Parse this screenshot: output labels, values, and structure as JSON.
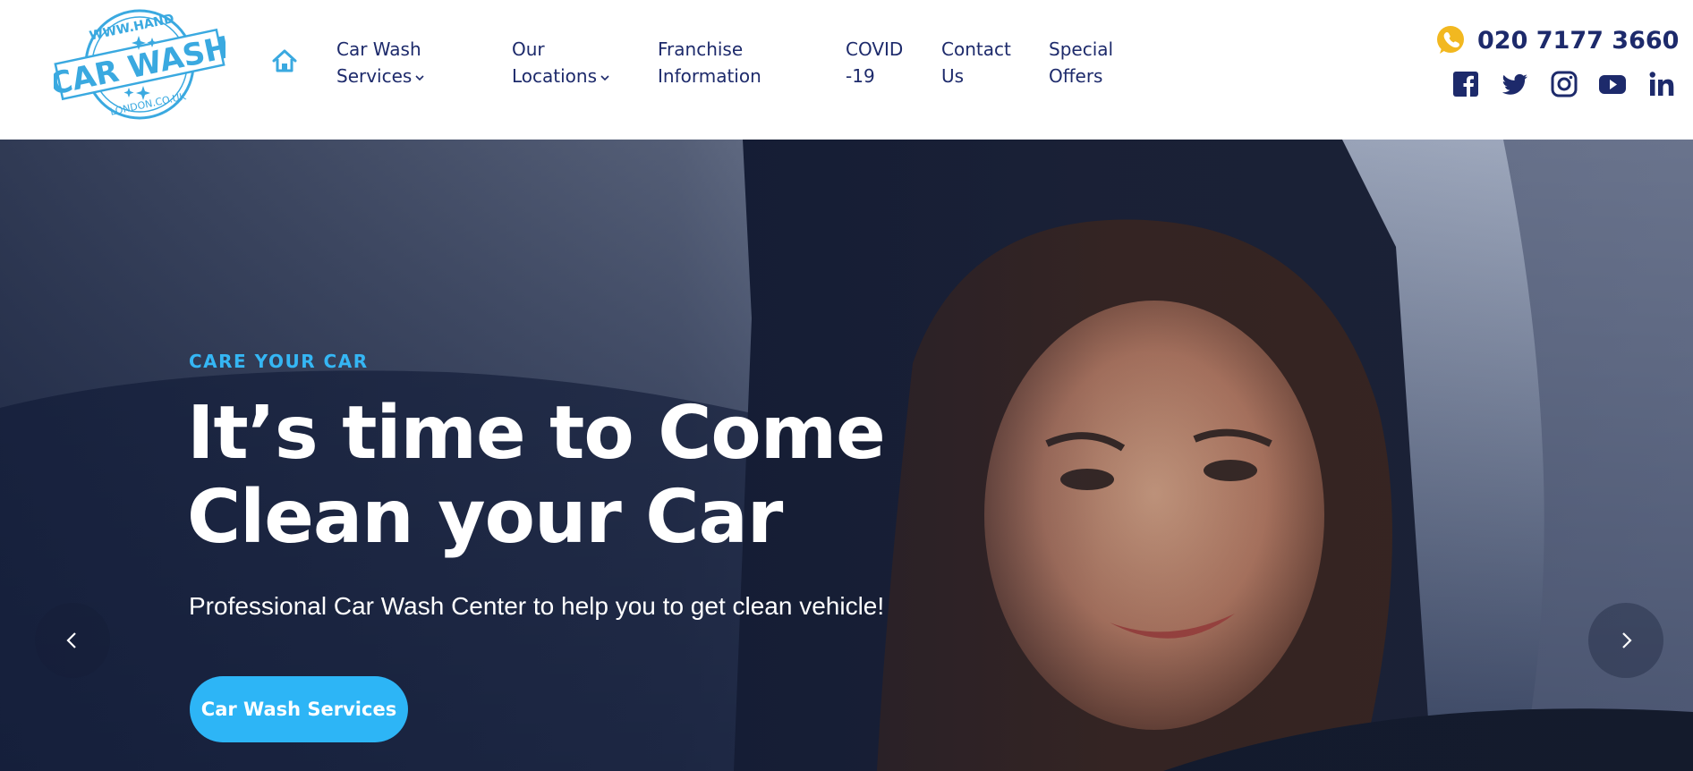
{
  "brand": {
    "logo_text": {
      "top": "WWW.HAND",
      "main": "CAR WASH",
      "bottom": "LONDON.CO.UK"
    },
    "colors": {
      "navy": "#1d2a6b",
      "accent_blue": "#2db5f6",
      "logo_blue": "#3aa9e0",
      "whatsapp_yellow": "#f2b820"
    }
  },
  "nav": {
    "home_icon": "home-icon",
    "items": [
      {
        "line1": "Car Wash",
        "line2": "Services",
        "dropdown": true
      },
      {
        "line1": "Our",
        "line2": "Locations",
        "dropdown": true
      },
      {
        "line1": "Franchise",
        "line2": "Information",
        "dropdown": false
      },
      {
        "line1": "COVID",
        "line2": "-19",
        "dropdown": false
      },
      {
        "line1": "Contact",
        "line2": "Us",
        "dropdown": false
      },
      {
        "line1": "Special",
        "line2": "Offers",
        "dropdown": false
      }
    ]
  },
  "contact": {
    "phone": "020 7177 3660",
    "phone_icon": "whatsapp-icon"
  },
  "social": [
    "facebook-icon",
    "twitter-icon",
    "instagram-icon",
    "youtube-icon",
    "linkedin-icon"
  ],
  "hero": {
    "eyebrow": "CARE YOUR CAR",
    "headline_line1": "It’s time to Come",
    "headline_line2": "Clean your Car",
    "subline": "Professional Car Wash Center to help you to get clean vehicle!",
    "cta_label": "Car Wash Services",
    "prev_icon": "chevron-left-icon",
    "next_icon": "chevron-right-icon"
  }
}
